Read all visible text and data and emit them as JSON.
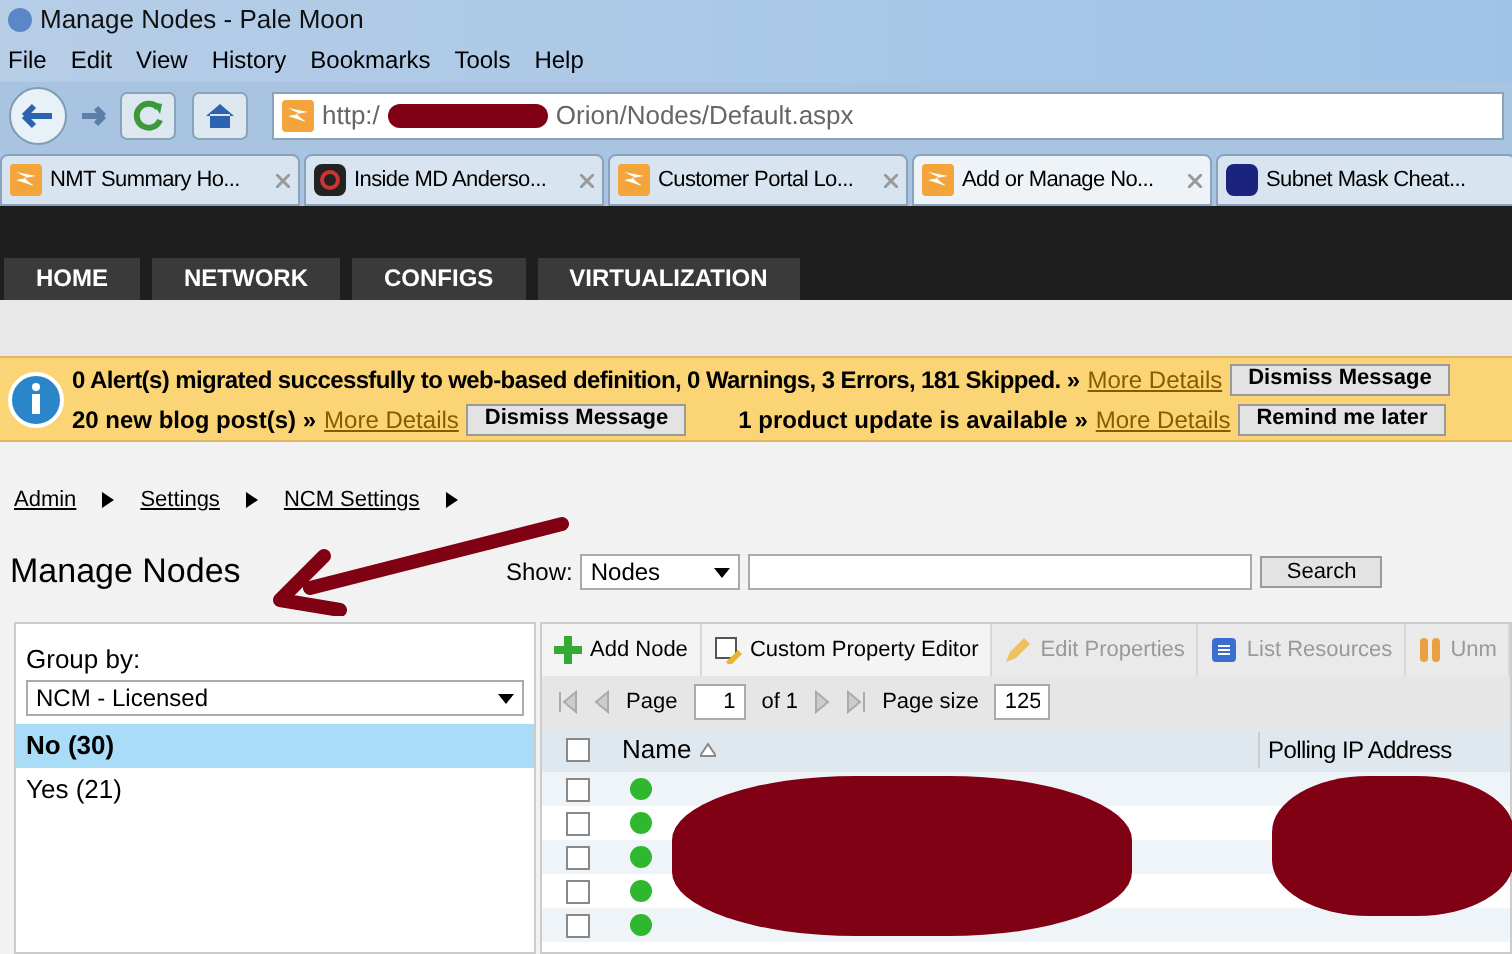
{
  "window": {
    "title": "Manage Nodes - Pale Moon"
  },
  "menu": [
    "File",
    "Edit",
    "View",
    "History",
    "Bookmarks",
    "Tools",
    "Help"
  ],
  "address": {
    "prefix": "http:/",
    "suffix": "Orion/Nodes/Default.aspx"
  },
  "browser_tabs": [
    {
      "title": "NMT Summary Ho...",
      "kind": "orange",
      "selected": false
    },
    {
      "title": "Inside MD Anderso...",
      "kind": "dark",
      "selected": false
    },
    {
      "title": "Customer Portal Lo...",
      "kind": "orange",
      "selected": false
    },
    {
      "title": "Add or Manage No...",
      "kind": "orange",
      "selected": true
    },
    {
      "title": "Subnet Mask Cheat...",
      "kind": "blue",
      "selected": false
    }
  ],
  "nav": [
    "HOME",
    "NETWORK",
    "CONFIGS",
    "VIRTUALIZATION"
  ],
  "alerts": [
    {
      "text": "0 Alert(s) migrated successfully to web-based definition, 0 Warnings, 3 Errors, 181 Skipped.",
      "separator": "»",
      "link": "More Details",
      "button": "Dismiss Message"
    },
    {
      "text": "20 new blog post(s)",
      "separator": "»",
      "link": "More Details",
      "button": "Dismiss Message"
    },
    {
      "text": "1 product update is available",
      "separator": "»",
      "link": "More Details",
      "button": "Remind me later"
    }
  ],
  "breadcrumb": [
    "Admin",
    "Settings",
    "NCM Settings"
  ],
  "page_title": "Manage Nodes",
  "show": {
    "label": "Show:",
    "value": "Nodes",
    "button": "Search"
  },
  "group_by": {
    "label": "Group by:",
    "value": "NCM - Licensed",
    "items": [
      {
        "label": "No (30)",
        "selected": true
      },
      {
        "label": "Yes (21)",
        "selected": false
      }
    ]
  },
  "toolbar": [
    {
      "label": "Add Node",
      "disabled": false,
      "kind": "plus"
    },
    {
      "label": "Custom Property Editor",
      "disabled": false,
      "kind": "editor"
    },
    {
      "label": "Edit Properties",
      "disabled": true,
      "kind": "pencil"
    },
    {
      "label": "List Resources",
      "disabled": true,
      "kind": "list"
    },
    {
      "label": "Unm",
      "disabled": true,
      "kind": "pause"
    }
  ],
  "pager": {
    "page_label": "Page",
    "page": "1",
    "of": "of 1",
    "size_label": "Page size",
    "size": "125"
  },
  "table": {
    "columns": [
      "Name",
      "Polling IP Address"
    ],
    "select_all_checked": false,
    "rows": [
      {
        "color": "#2fb82f",
        "checked": false
      },
      {
        "color": "#2fb82f",
        "checked": false
      },
      {
        "color": "#2fb82f",
        "checked": false
      },
      {
        "color": "#2fb82f",
        "checked": false
      },
      {
        "color": "#2fb82f",
        "checked": false
      }
    ]
  }
}
